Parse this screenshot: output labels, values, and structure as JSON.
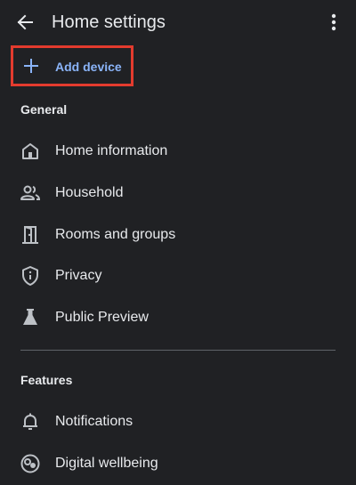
{
  "header": {
    "title": "Home settings",
    "back_icon": "arrow-back-icon",
    "more_icon": "more-vertical-icon"
  },
  "add_device": {
    "label": "Add device",
    "icon": "plus-icon",
    "accent_color": "#8ab4f8",
    "highlight_color": "#e33b2e"
  },
  "sections": [
    {
      "title": "General",
      "items": [
        {
          "label": "Home information",
          "icon": "home-icon"
        },
        {
          "label": "Household",
          "icon": "people-icon"
        },
        {
          "label": "Rooms and groups",
          "icon": "door-icon"
        },
        {
          "label": "Privacy",
          "icon": "shield-info-icon"
        },
        {
          "label": "Public Preview",
          "icon": "flask-icon"
        }
      ]
    },
    {
      "title": "Features",
      "items": [
        {
          "label": "Notifications",
          "icon": "bell-icon"
        },
        {
          "label": "Digital wellbeing",
          "icon": "digital-wellbeing-icon"
        }
      ]
    }
  ],
  "colors": {
    "background": "#202124",
    "text": "#e8eaed",
    "icon": "#bdc1c6",
    "divider": "#5f6368"
  }
}
